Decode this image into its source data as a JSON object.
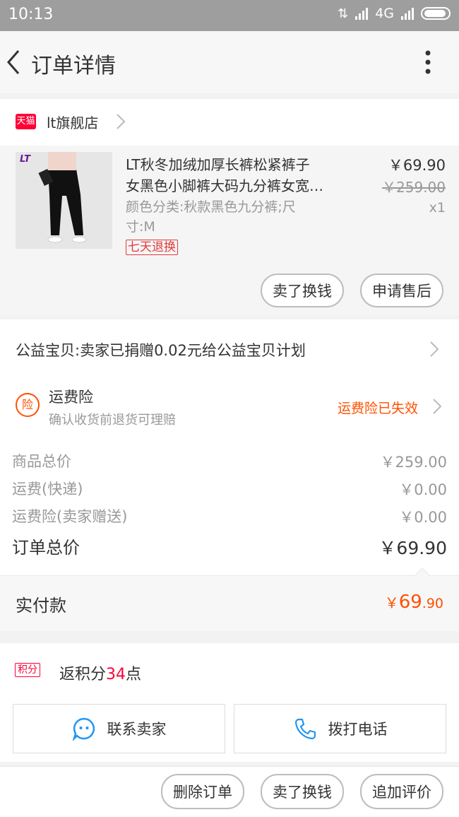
{
  "status": {
    "time": "10:13",
    "network": "4G"
  },
  "header": {
    "title": "订单详情"
  },
  "store": {
    "badge": "天猫",
    "name": "lt旗舰店"
  },
  "item": {
    "title_line1": "LT秋冬加绒加厚长裤松紧裤子",
    "title_line2": "女黑色小脚裤大码九分裤女宽…",
    "sku_line1": "颜色分类:秋款黑色九分裤;尺",
    "sku_line2": "寸:M",
    "tag": "七天退换",
    "price": "￥69.90",
    "original_price": "￥259.00",
    "qty": "x1",
    "thumb_logo": "LT"
  },
  "item_actions": {
    "sell": "卖了换钱",
    "after_sale": "申请售后"
  },
  "charity": {
    "text": "公益宝贝:卖家已捐赠0.02元给公益宝贝计划"
  },
  "insurance": {
    "icon_char": "险",
    "title": "运费险",
    "subtitle": "确认收货前退货可理赔",
    "status": "运费险已失效"
  },
  "summary": {
    "rows": [
      {
        "label": "商品总价",
        "value": "￥259.00"
      },
      {
        "label": "运费(快递)",
        "value": "￥0.00"
      },
      {
        "label": "运费险(卖家赠送)",
        "value": "￥0.00"
      }
    ],
    "total_label": "订单总价",
    "total_value": "￥69.90"
  },
  "payment": {
    "label": "实付款",
    "currency": "￥",
    "int": "69",
    "dec": ".90"
  },
  "points": {
    "badge": "积分",
    "prefix": "返积分",
    "value": "34",
    "suffix": "点"
  },
  "contact": {
    "seller": "联系卖家",
    "call": "拨打电话"
  },
  "bottom_actions": {
    "delete": "删除订单",
    "sell": "卖了换钱",
    "review": "追加评价"
  },
  "colors": {
    "accent": "#ff5000",
    "tmall": "#ff0036",
    "blue": "#2196f3"
  }
}
